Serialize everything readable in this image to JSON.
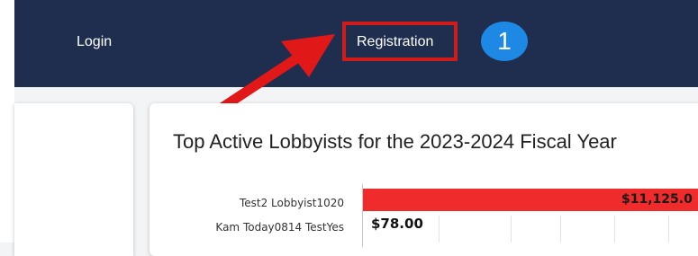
{
  "nav": {
    "login_label": "Login",
    "registration_label": "Registration"
  },
  "annotation": {
    "step_number": "1",
    "highlight_color": "#d01b1b",
    "badge_color": "#1e88e5"
  },
  "colors": {
    "navbar": "#1f2e4f",
    "bar": "#ef2b2b"
  },
  "main": {
    "title": "Top Active Lobbyists for the 2023-2024 Fiscal Year"
  },
  "chart_data": {
    "type": "bar",
    "orientation": "horizontal",
    "categories": [
      "Test2 Lobbyist1020",
      "Kam Today0814 TestYes"
    ],
    "values": [
      11125.0,
      78.0
    ],
    "value_labels": [
      "$11,125.0",
      "$78.00"
    ],
    "title": "",
    "xlabel": "",
    "ylabel": ""
  }
}
